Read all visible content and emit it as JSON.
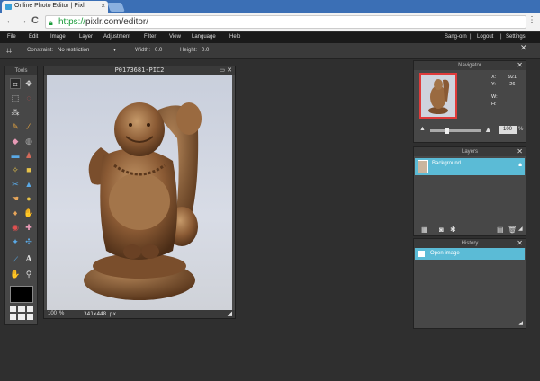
{
  "browser": {
    "tab_title": "Online Photo Editor | Pixlr",
    "tab_close": "×",
    "url_https": "https://",
    "url_rest": "pixlr.com/editor/",
    "back": "←",
    "forward": "→",
    "reload": "C",
    "menu": "⋮"
  },
  "menubar": {
    "items": [
      "File",
      "Edit",
      "Image",
      "Layer",
      "Adjustment",
      "Filter",
      "View",
      "Language",
      "Help"
    ],
    "user": "Sang-orn",
    "logout": "Logout",
    "settings": "Settings"
  },
  "options": {
    "constraint_label": "Constraint:",
    "constraint_value": "No restriction",
    "width_label": "Width:",
    "width_value": "0.0",
    "height_label": "Height:",
    "height_value": "0.0"
  },
  "tools": {
    "title": "Tools",
    "text_tool": "A"
  },
  "document": {
    "title": "P0173681-PIC2",
    "zoom": "100",
    "zoom_unit": "%",
    "dimensions": "341x448 px"
  },
  "navigator": {
    "title": "Navigator",
    "x_label": "X:",
    "x_value": "921",
    "y_label": "Y:",
    "y_value": "-26",
    "w_label": "W:",
    "h_label": "H:",
    "zoom_value": "100",
    "zoom_unit": "%"
  },
  "layers": {
    "title": "Layers",
    "items": [
      {
        "name": "Background"
      }
    ]
  },
  "history": {
    "title": "History",
    "items": [
      {
        "name": "Open image"
      }
    ]
  },
  "colors": {
    "layer_highlight": "#5bbbd6",
    "navigator_frame": "#e03b3b",
    "secure_url": "#1a9c3a"
  }
}
